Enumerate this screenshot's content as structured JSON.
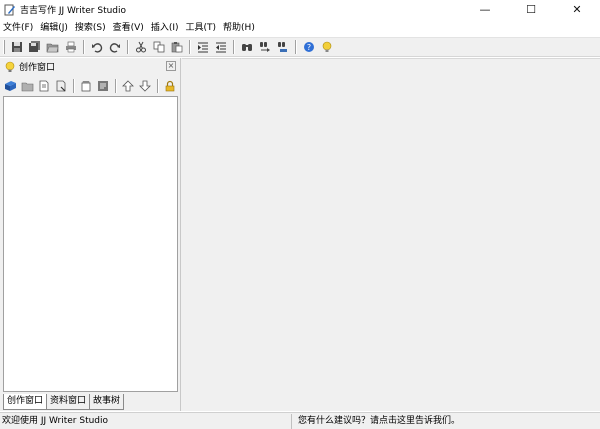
{
  "window": {
    "title": "吉吉写作 JJ Writer Studio",
    "app_icon": "pen-document-icon",
    "controls": {
      "minimize": "—",
      "maximize": "☐",
      "close": "✕"
    }
  },
  "menu": {
    "items": [
      {
        "label": "文件(F)"
      },
      {
        "label": "编辑(J)"
      },
      {
        "label": "搜索(S)"
      },
      {
        "label": "查看(V)"
      },
      {
        "label": "插入(I)"
      },
      {
        "label": "工具(T)"
      },
      {
        "label": "帮助(H)"
      }
    ]
  },
  "toolbar": {
    "buttons": [
      "save-icon",
      "save-all-icon",
      "open-folder-icon",
      "print-icon",
      "undo-icon",
      "redo-icon",
      "cut-icon",
      "copy-icon",
      "paste-icon",
      "indent-icon",
      "outdent-icon",
      "find-icon",
      "replace-icon",
      "find-next-icon",
      "help-icon",
      "tip-icon"
    ]
  },
  "panel": {
    "title": "创作窗口",
    "close_glyph": "×",
    "toolbar_buttons": [
      "book-icon",
      "folder-icon",
      "new-doc-icon",
      "doc-icon",
      "properties-icon",
      "notes-icon",
      "move-up-icon",
      "move-down-icon",
      "lock-icon"
    ],
    "tabs": [
      {
        "label": "创作窗口",
        "active": true
      },
      {
        "label": "资料窗口",
        "active": false
      },
      {
        "label": "故事树",
        "active": false
      }
    ]
  },
  "status": {
    "left": "欢迎使用 JJ Writer Studio",
    "right": "您有什么建议吗？请点击这里告诉我们。"
  }
}
